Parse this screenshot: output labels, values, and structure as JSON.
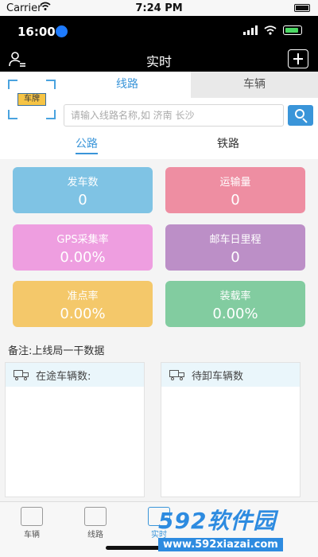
{
  "sim_status": {
    "carrier": "Carrier",
    "time": "7:24 PM"
  },
  "status_bar": {
    "time": "16:00"
  },
  "navbar": {
    "title": "实时"
  },
  "header": {
    "scan_plate": "车牌",
    "tabs": [
      {
        "label": "线路",
        "active": true
      },
      {
        "label": "车辆",
        "active": false
      }
    ],
    "search": {
      "placeholder": "请输入线路名称,如 济南 长沙"
    },
    "subtabs": [
      {
        "label": "公路",
        "active": true
      },
      {
        "label": "铁路",
        "active": false
      }
    ]
  },
  "stats": [
    {
      "label": "发车数",
      "value": "0",
      "color": "#7fc3e4"
    },
    {
      "label": "运输量",
      "value": "0",
      "color": "#ee8ea2"
    },
    {
      "label": "GPS采集率",
      "value": "0.00%",
      "color": "#ee9ee0"
    },
    {
      "label": "邮车日里程",
      "value": "0",
      "color": "#bc8fc7"
    },
    {
      "label": "准点率",
      "value": "0.00%",
      "color": "#f4c86a"
    },
    {
      "label": "装载率",
      "value": "0.00%",
      "color": "#82cca0"
    }
  ],
  "note": "备注:上线局一干数据",
  "panels": [
    {
      "title": "在途车辆数:"
    },
    {
      "title": "待卸车辆数"
    }
  ],
  "tabbar": [
    {
      "label": "车辆",
      "active": false
    },
    {
      "label": "线路",
      "active": false
    },
    {
      "label": "实时",
      "active": true
    }
  ],
  "watermark": {
    "brand": "592软件园",
    "url": "www.592xiazai.com"
  },
  "colors": {
    "accent": "#3a95d9"
  }
}
